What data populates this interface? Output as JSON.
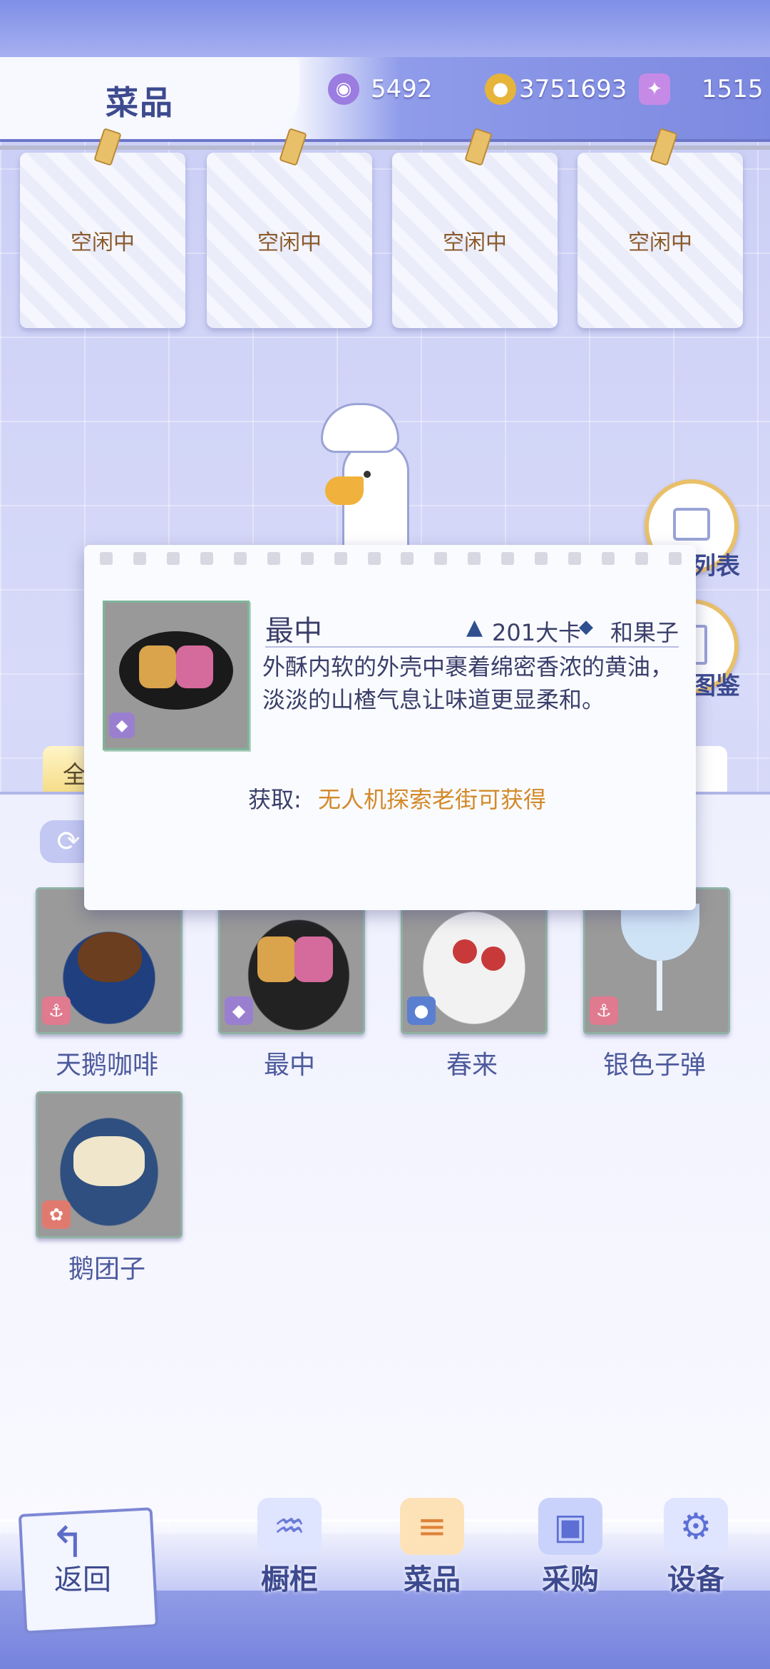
{
  "header": {
    "title": "菜品",
    "currencies": [
      {
        "icon": "purple-gem-icon",
        "value": "5492"
      },
      {
        "icon": "gold-coin-icon",
        "value": "3751693"
      },
      {
        "icon": "swan-ticket-icon",
        "value": "1515"
      }
    ]
  },
  "orders": [
    {
      "status": "空闲中"
    },
    {
      "status": "空闲中"
    },
    {
      "status": "空闲中"
    },
    {
      "status": "空闲中"
    }
  ],
  "side_buttons": [
    {
      "icon": "box-list-icon",
      "label": "列表"
    },
    {
      "icon": "book-catalog-icon",
      "label": "图鉴"
    }
  ],
  "tabs": {
    "all_label": "全"
  },
  "dishes": [
    {
      "name": "天鹅咖啡",
      "badge": "anchor-icon",
      "badge_color": "#e07a8f"
    },
    {
      "name": "最中",
      "badge": "diamond-icon",
      "badge_color": "#9a7fd1"
    },
    {
      "name": "春来",
      "badge": "lightbulb-icon",
      "badge_color": "#5a7fd1"
    },
    {
      "name": "银色子弹",
      "badge": "anchor-icon",
      "badge_color": "#e07a8f"
    },
    {
      "name": "鹅团子",
      "badge": "goose-icon",
      "badge_color": "#e07a6f"
    }
  ],
  "popup": {
    "dish_name": "最中",
    "kcal": "201大卡",
    "category": "和果子",
    "description": "外酥内软的外壳中裹着绵密香浓的黄油，淡淡的山楂气息让味道更显柔和。",
    "obtain_label": "获取:",
    "obtain_value": "无人机探索老街可获得"
  },
  "nav": {
    "back_label": "返回",
    "items": [
      {
        "label": "橱柜",
        "icon": "drink-burger-icon"
      },
      {
        "label": "菜品",
        "icon": "burger-icon",
        "active": true
      },
      {
        "label": "采购",
        "icon": "shopping-bag-icon"
      },
      {
        "label": "设备",
        "icon": "coffee-machine-icon"
      }
    ]
  },
  "colors": {
    "accent": "#7c89e0",
    "text_primary": "#3d4a8f",
    "obtain_highlight": "#d38a2a"
  }
}
